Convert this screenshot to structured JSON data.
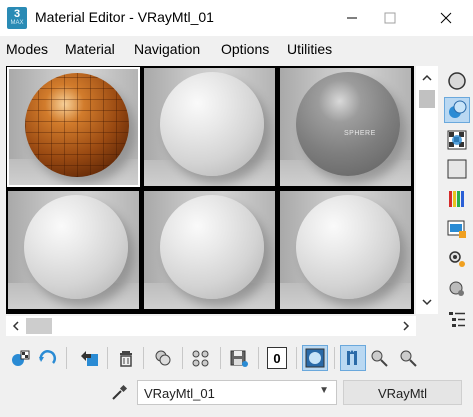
{
  "window": {
    "title": "Material Editor - VRayMtl_01",
    "app_icon_number": "3",
    "app_icon_sub": "MAX"
  },
  "menu": [
    "Modes",
    "Material",
    "Navigation",
    "Options",
    "Utilities"
  ],
  "sample_slots": [
    {
      "material": "copper-tiled",
      "active": true
    },
    {
      "material": "default-gray",
      "active": false
    },
    {
      "material": "glossy-gray",
      "active": false,
      "overlay_text": "SPHERE"
    },
    {
      "material": "default-gray",
      "active": false
    },
    {
      "material": "default-gray",
      "active": false
    },
    {
      "material": "default-gray",
      "active": false
    }
  ],
  "slot_id": "0",
  "material_name": "VRayMtl_01",
  "material_type": "VRayMtl",
  "colors": {
    "accent_highlight": "#b9d8f2",
    "accent_border": "#6aa8dc",
    "app_icon": "#2a8bb5"
  }
}
